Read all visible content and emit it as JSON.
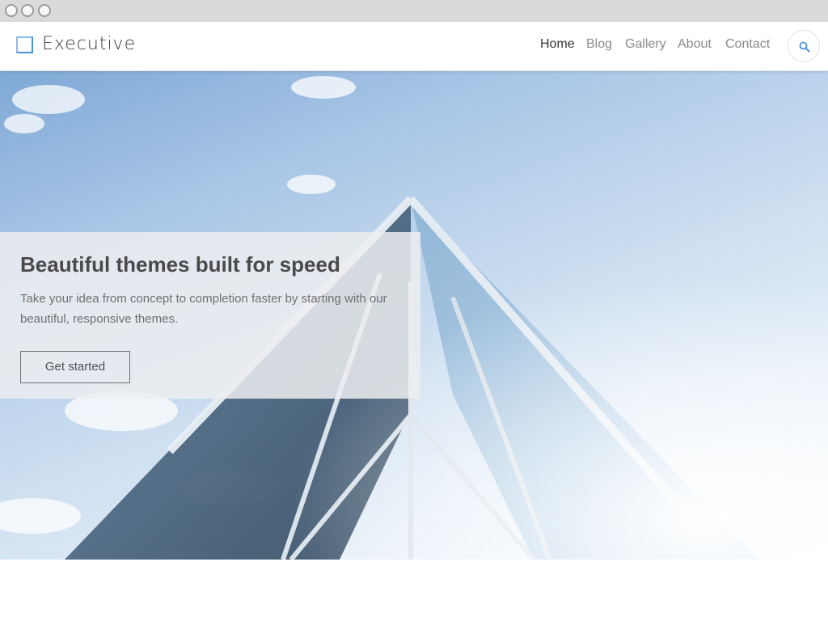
{
  "window": {
    "controls": [
      "close-dot",
      "minimize-dot",
      "maximize-dot"
    ]
  },
  "header": {
    "logo_icon": "square-bracket-logo-icon",
    "logo_text": "Executive",
    "nav": [
      {
        "label": "Home",
        "active": true
      },
      {
        "label": "Blog",
        "active": false
      },
      {
        "label": "Gallery",
        "active": false
      },
      {
        "label": "About",
        "active": false
      },
      {
        "label": "Contact",
        "active": false
      }
    ],
    "search_icon": "search-icon"
  },
  "hero": {
    "title": "Beautiful themes built for speed",
    "text": "Take your idea from concept to completion faster by starting with our beautiful, responsive themes.",
    "button_label": "Get started",
    "background_image": "glass-building-against-sky"
  },
  "colors": {
    "accent": "#4a90d9",
    "nav_active": "#333333",
    "nav_inactive": "#8a8a8a",
    "hero_title": "#4a4a4a"
  }
}
